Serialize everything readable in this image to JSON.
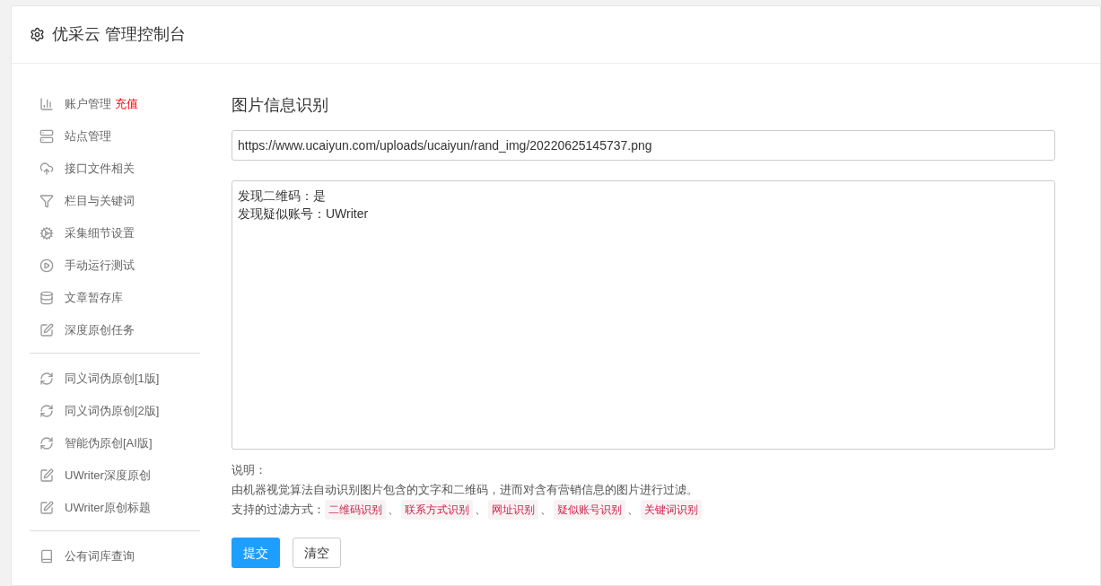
{
  "header": {
    "title": "优采云 管理控制台"
  },
  "sidebar": {
    "groups": [
      {
        "items": [
          {
            "kind": "chart",
            "label": "账户管理",
            "badge": "充值"
          },
          {
            "kind": "server",
            "label": "站点管理"
          },
          {
            "kind": "cloud",
            "label": "接口文件相关"
          },
          {
            "kind": "filter",
            "label": "栏目与关键词"
          },
          {
            "kind": "gears",
            "label": "采集细节设置"
          },
          {
            "kind": "play",
            "label": "手动运行测试"
          },
          {
            "kind": "database",
            "label": "文章暂存库"
          },
          {
            "kind": "edit",
            "label": "深度原创任务"
          }
        ]
      },
      {
        "items": [
          {
            "kind": "refresh",
            "label": "同义词伪原创[1版]"
          },
          {
            "kind": "refresh",
            "label": "同义词伪原创[2版]"
          },
          {
            "kind": "refresh",
            "label": "智能伪原创[AI版]"
          },
          {
            "kind": "edit",
            "label": "UWriter深度原创"
          },
          {
            "kind": "edit",
            "label": "UWriter原创标题"
          }
        ]
      },
      {
        "items": [
          {
            "kind": "book",
            "label": "公有词库查询"
          }
        ]
      }
    ]
  },
  "main": {
    "title": "图片信息识别",
    "url_field": {
      "value": "https://www.ucaiyun.com/uploads/ucaiyun/rand_img/20220625145737.png"
    },
    "result": {
      "lines": [
        "发现二维码：是",
        "发现疑似账号：UWriter"
      ]
    },
    "note_label": "说明：",
    "description": "由机器视觉算法自动识别图片包含的文字和二维码，进而对含有营销信息的图片进行过滤。",
    "methods_label": "支持的过滤方式：",
    "methods": [
      "二维码识别",
      "联系方式识别",
      "网址识别",
      "疑似账号识别",
      "关键词识别"
    ],
    "separator": "、",
    "buttons": [
      {
        "kind": "primary",
        "label": "提交"
      },
      {
        "kind": "default",
        "label": "清空"
      }
    ]
  }
}
